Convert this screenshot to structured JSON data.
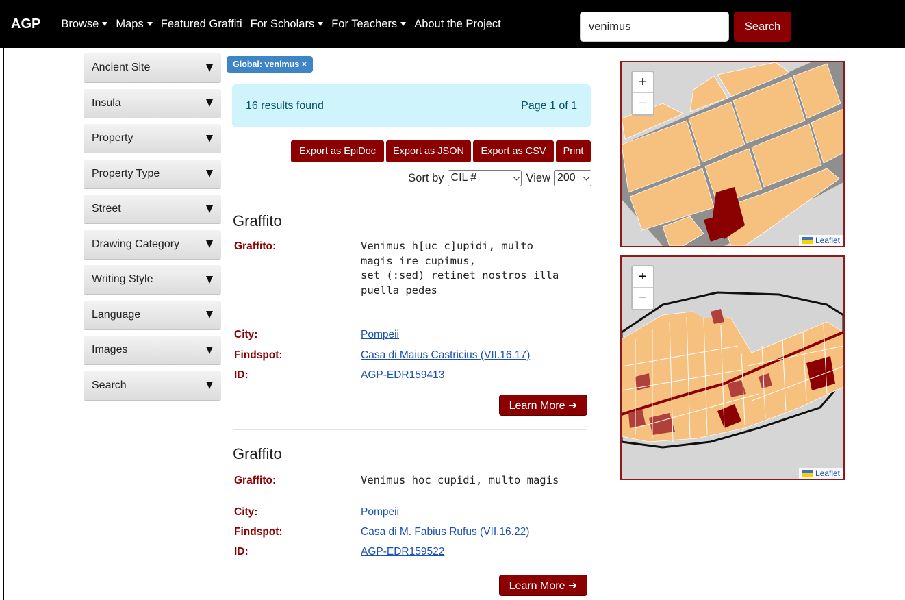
{
  "navbar": {
    "brand": "AGP",
    "items": [
      {
        "label": "Browse",
        "dropdown": true
      },
      {
        "label": "Maps",
        "dropdown": true
      },
      {
        "label": "Featured Graffiti",
        "dropdown": false
      },
      {
        "label": "For Scholars",
        "dropdown": true
      },
      {
        "label": "For Teachers",
        "dropdown": true
      },
      {
        "label": "About the Project",
        "dropdown": false
      }
    ],
    "search_value": "venimus",
    "search_button": "Search"
  },
  "sidebar": {
    "filters": [
      "Ancient Site",
      "Insula",
      "Property",
      "Property Type",
      "Street",
      "Drawing Category",
      "Writing Style",
      "Language",
      "Images",
      "Search"
    ]
  },
  "main": {
    "active_filter_badge": "Global: venimus ×",
    "results_count": "16 results found",
    "page_info": "Page 1 of 1",
    "export_buttons": [
      "Export as EpiDoc",
      "Export as JSON",
      "Export as CSV",
      "Print"
    ],
    "sort_label": "Sort by",
    "sort_value": "CIL #",
    "view_label": "View",
    "view_value": "200",
    "labels": {
      "graffito": "Graffito:",
      "city": "City:",
      "findspot": "Findspot:",
      "id": "ID:"
    },
    "learn_more": "Learn More ➜",
    "results": [
      {
        "title": "Graffito",
        "text_lines": [
          "Venimus h[uc c]upidi, multo",
          "magis ire cupimus,",
          "set (:sed) retinet nostros illa",
          "puella pedes"
        ],
        "city": "Pompeii",
        "findspot": "Casa di Maius Castricius (VII.16.17)",
        "id": "AGP-EDR159413"
      },
      {
        "title": "Graffito",
        "text_lines": [
          "Venimus hoc cupidi, multo magis"
        ],
        "city": "Pompeii",
        "findspot": "Casa di M. Fabius Rufus (VII.16.22)",
        "id": "AGP-EDR159522"
      }
    ]
  },
  "maps": {
    "zoom_in": "+",
    "zoom_out": "−",
    "attribution": "Leaflet",
    "colors": {
      "insula": "#f6c07e",
      "street": "#8f8f8f",
      "highlight": "#8b0000",
      "frame": "#8b1a1a"
    }
  }
}
